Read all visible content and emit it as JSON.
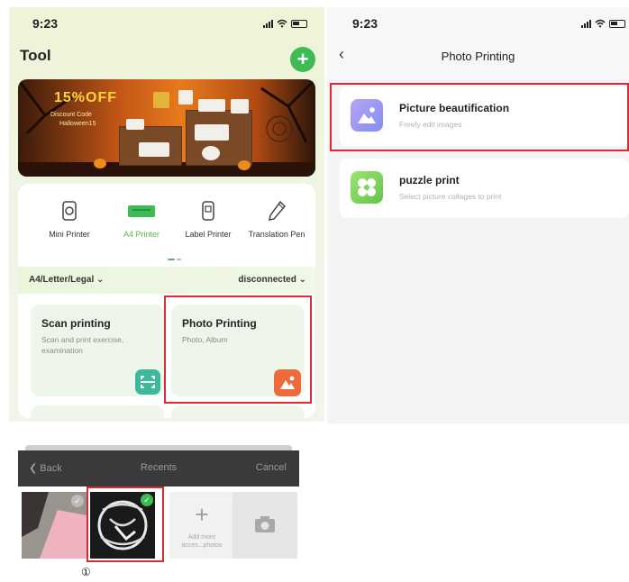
{
  "left_phone": {
    "status": {
      "time": "9:23"
    },
    "header": {
      "title": "Tool",
      "add_label": "+"
    },
    "banner": {
      "sale_text": "15%OFF",
      "code_line1": "Discount Code",
      "code_line2": "Halloween15"
    },
    "devices": [
      {
        "label": "Mini Printer",
        "icon": "mini-printer-icon",
        "active": false
      },
      {
        "label": "A4 Printer",
        "icon": "a4-printer-icon",
        "active": true
      },
      {
        "label": "Label Printer",
        "icon": "label-printer-icon",
        "active": false
      },
      {
        "label": "Translation Pen",
        "icon": "translation-pen-icon",
        "active": false
      }
    ],
    "paper_bar": {
      "paper_size": "A4/Letter/Legal",
      "connection": "disconnected"
    },
    "cards": [
      {
        "title": "Scan printing",
        "subtitle": "Scan and print exercise, examination",
        "icon": "scan-icon",
        "icon_color": "#3cb89a"
      },
      {
        "title": "Photo Printing",
        "subtitle": "Photo, Album",
        "icon": "photo-icon",
        "icon_color": "#ee6a3a"
      }
    ]
  },
  "picker": {
    "back_label": "Back",
    "title": "Recents",
    "cancel_label": "Cancel",
    "add_more_caption": "Add more acces...photos",
    "step_marker": "①"
  },
  "right_phone": {
    "status": {
      "time": "9:23"
    },
    "title": "Photo Printing",
    "items": [
      {
        "title": "Picture beautification",
        "subtitle": "Freely edit images",
        "icon": "picture-icon",
        "icon_color": "#8a7df0"
      },
      {
        "title": "puzzle print",
        "subtitle": "Select picture collages to print",
        "icon": "puzzle-icon",
        "icon_color": "#7fd35a"
      }
    ]
  },
  "colors": {
    "accent_green": "#3dbb54",
    "highlight_red": "#d62b34"
  }
}
